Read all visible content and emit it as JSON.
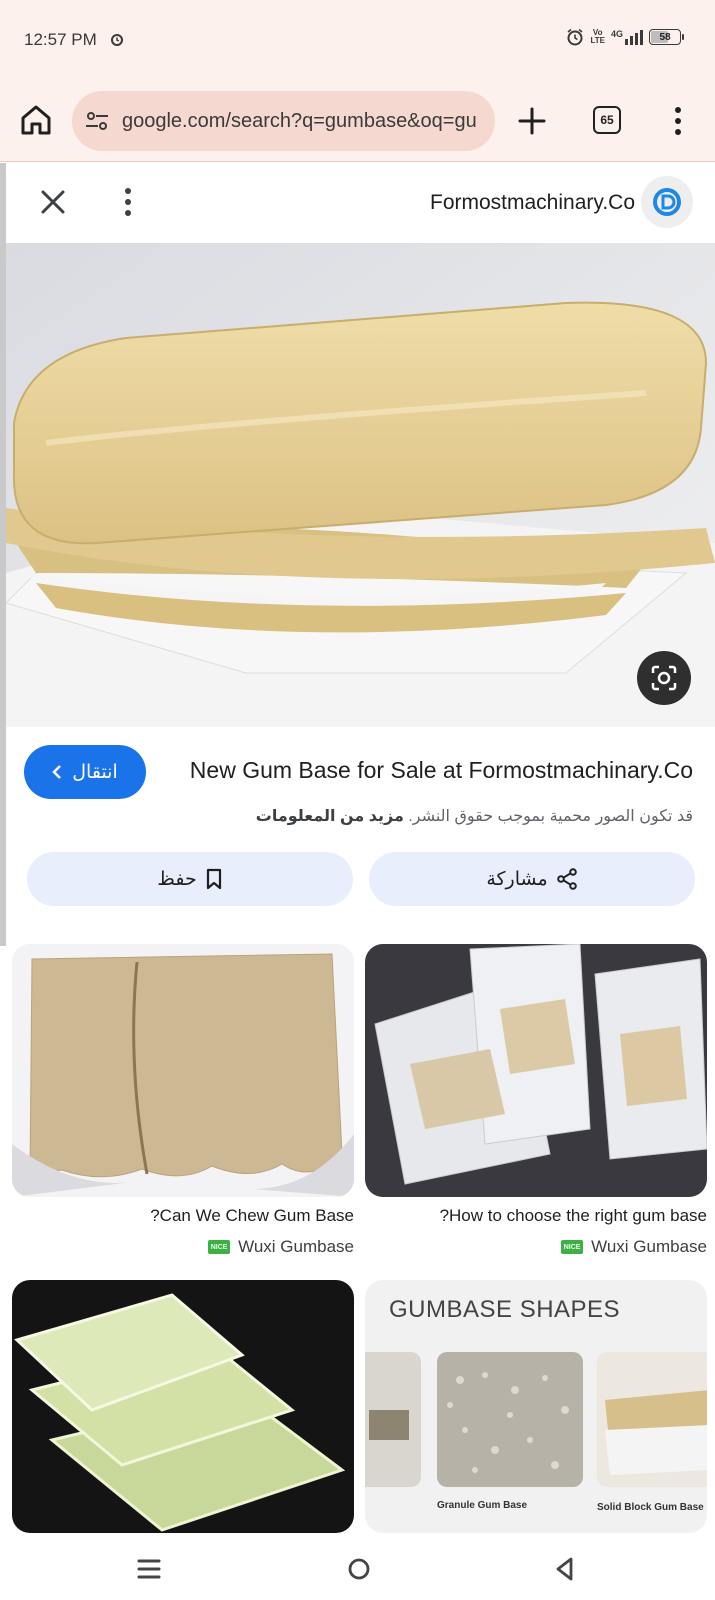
{
  "status": {
    "time": "12:57 PM",
    "volte_top": "Vo",
    "volte_bottom": "LTE",
    "network": "4G",
    "battery": "58",
    "battery_level": 0.58
  },
  "browser": {
    "url": "google.com/search?q=gumbase&oq=gu",
    "tab_count": "65",
    "icons": [
      "home-icon",
      "tune-icon",
      "plus-icon",
      "tab-switcher-icon",
      "more-vert-icon"
    ]
  },
  "panel": {
    "site_name": "Formostmachinary.Co",
    "go_label": "انتقال",
    "result_title": "New Gum Base for Sale at Formostmachinary.Co",
    "copyright_text": "قد تكون الصور محمية بموجب حقوق النشر.",
    "more_info": "مزيد من المعلومات",
    "save_label": "حفظ",
    "share_label": "مشاركة",
    "accent_color": "#1a73e8"
  },
  "results": [
    {
      "title": "?Can We Chew Gum Base",
      "source": "Wuxi Gumbase",
      "badge": "NICE"
    },
    {
      "title": "?How to choose the right gum base",
      "source": "Wuxi Gumbase",
      "badge": "NICE"
    },
    {
      "overlay_title": "GUMBASE SHAPES",
      "labels": [
        "Granule Gum Base",
        "Solid Block Gum Base"
      ]
    }
  ]
}
